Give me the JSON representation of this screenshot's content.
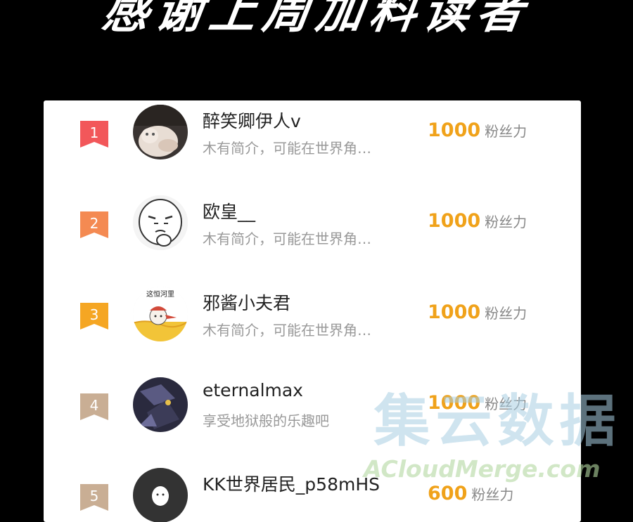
{
  "header": {
    "title": "感谢上周加料读者"
  },
  "list": {
    "fans_unit": "粉丝力",
    "items": [
      {
        "rank": "1",
        "name": "醉笑卿伊人v",
        "bio": "木有简介，可能在世界角…",
        "fans": "1000",
        "badge_color": "#f2575a"
      },
      {
        "rank": "2",
        "name": "欧皇__",
        "bio": "木有简介，可能在世界角…",
        "fans": "1000",
        "badge_color": "#f48a52"
      },
      {
        "rank": "3",
        "name": "邪酱小夫君",
        "bio": "木有简介，可能在世界角…",
        "fans": "1000",
        "badge_color": "#f5a623"
      },
      {
        "rank": "4",
        "name": "eternalmax",
        "bio": "享受地狱般的乐趣吧",
        "fans": "1000",
        "badge_color": "#c9ae94"
      },
      {
        "rank": "5",
        "name": "KK世界居民_p58mHS",
        "bio": "",
        "fans": "600",
        "badge_color": "#c9ae94"
      }
    ]
  },
  "avatars": {
    "3_caption": "这恒河里"
  },
  "watermark": {
    "cn": "集云数据",
    "en": "ACloudMerge.com"
  },
  "colors": {
    "fans_number": "#f0a21a",
    "name_text": "#222222",
    "bio_text": "#999999"
  }
}
